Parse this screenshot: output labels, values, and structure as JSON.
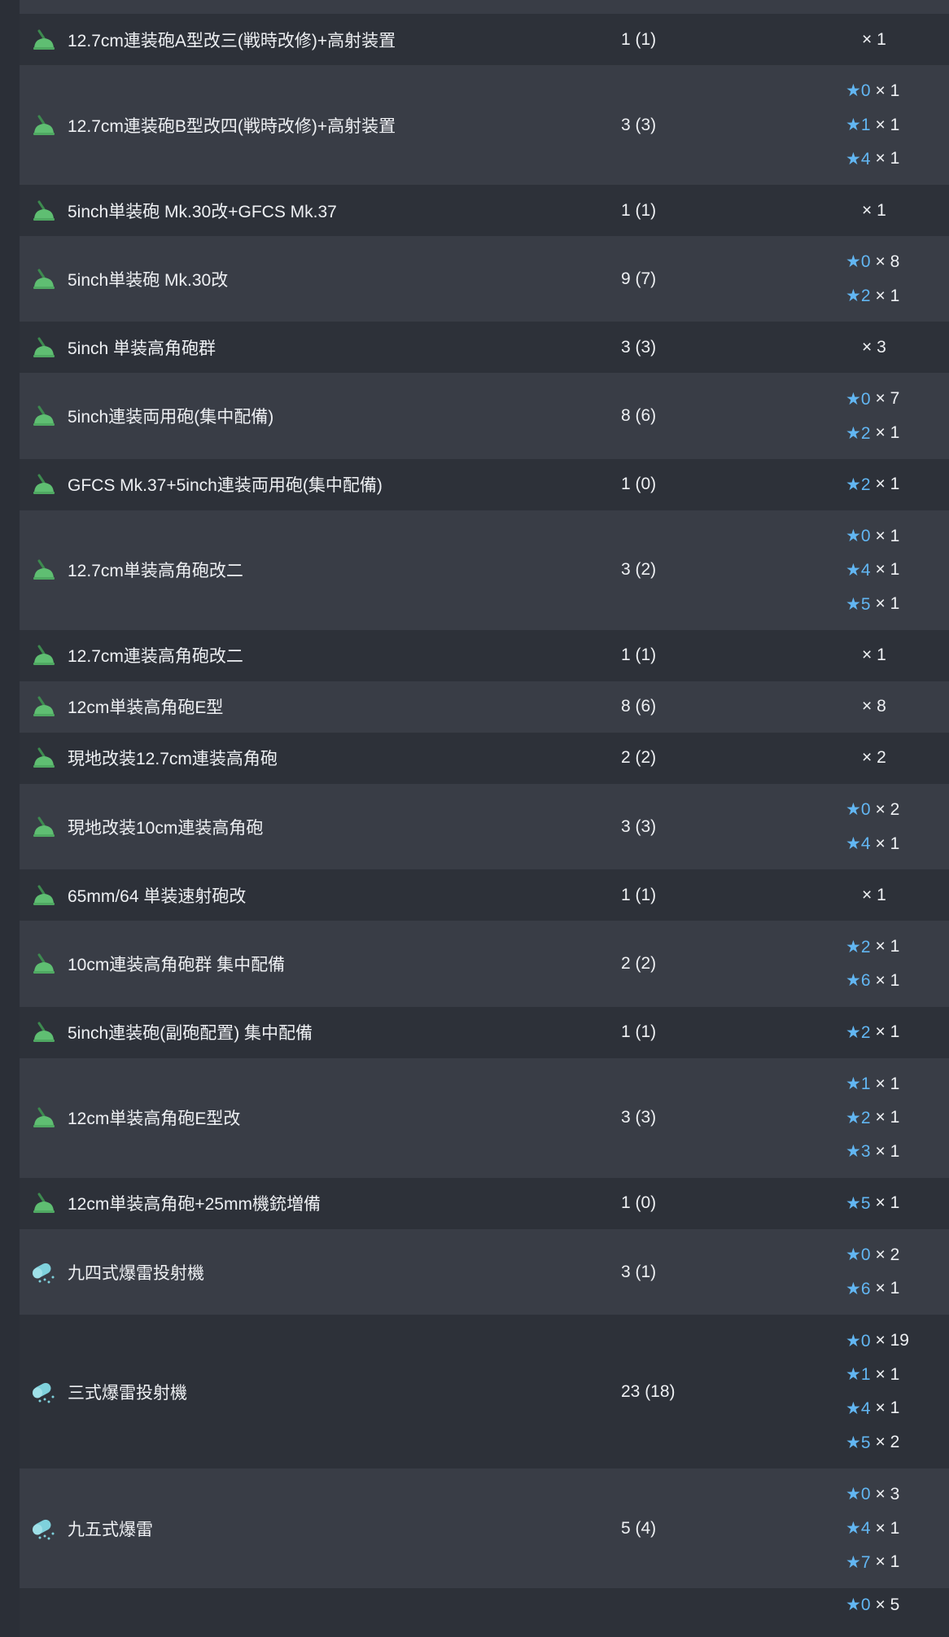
{
  "rows": [
    {
      "icon": "gun-mount-icon",
      "name": "12.7cm連装砲A型改三(戦時改修)+高射装置",
      "count": "1 (1)",
      "stars": [],
      "total": "× 1"
    },
    {
      "icon": "gun-mount-icon",
      "name": "12.7cm連装砲B型改四(戦時改修)+高射装置",
      "count": "3 (3)",
      "stars": [
        {
          "star": "★0",
          "mult": "× 1"
        },
        {
          "star": "★1",
          "mult": "× 1"
        },
        {
          "star": "★4",
          "mult": "× 1"
        }
      ]
    },
    {
      "icon": "gun-mount-icon",
      "name": "5inch単装砲 Mk.30改+GFCS Mk.37",
      "count": "1 (1)",
      "stars": [],
      "total": "× 1"
    },
    {
      "icon": "gun-mount-icon",
      "name": "5inch単装砲 Mk.30改",
      "count": "9 (7)",
      "stars": [
        {
          "star": "★0",
          "mult": "× 8"
        },
        {
          "star": "★2",
          "mult": "× 1"
        }
      ]
    },
    {
      "icon": "gun-mount-icon",
      "name": "5inch 単装高角砲群",
      "count": "3 (3)",
      "stars": [],
      "total": "× 3"
    },
    {
      "icon": "gun-mount-icon",
      "name": "5inch連装両用砲(集中配備)",
      "count": "8 (6)",
      "stars": [
        {
          "star": "★0",
          "mult": "× 7"
        },
        {
          "star": "★2",
          "mult": "× 1"
        }
      ]
    },
    {
      "icon": "gun-mount-icon",
      "name": "GFCS Mk.37+5inch連装両用砲(集中配備)",
      "count": "1 (0)",
      "stars": [
        {
          "star": "★2",
          "mult": "× 1"
        }
      ]
    },
    {
      "icon": "gun-mount-icon",
      "name": "12.7cm単装高角砲改二",
      "count": "3 (2)",
      "stars": [
        {
          "star": "★0",
          "mult": "× 1"
        },
        {
          "star": "★4",
          "mult": "× 1"
        },
        {
          "star": "★5",
          "mult": "× 1"
        }
      ]
    },
    {
      "icon": "gun-mount-icon",
      "name": "12.7cm連装高角砲改二",
      "count": "1 (1)",
      "stars": [],
      "total": "× 1"
    },
    {
      "icon": "gun-mount-icon",
      "name": "12cm単装高角砲E型",
      "count": "8 (6)",
      "stars": [],
      "total": "× 8"
    },
    {
      "icon": "gun-mount-icon",
      "name": "現地改装12.7cm連装高角砲",
      "count": "2 (2)",
      "stars": [],
      "total": "× 2"
    },
    {
      "icon": "gun-mount-icon",
      "name": "現地改装10cm連装高角砲",
      "count": "3 (3)",
      "stars": [
        {
          "star": "★0",
          "mult": "× 2"
        },
        {
          "star": "★4",
          "mult": "× 1"
        }
      ]
    },
    {
      "icon": "gun-mount-icon",
      "name": "65mm/64 単装速射砲改",
      "count": "1 (1)",
      "stars": [],
      "total": "× 1"
    },
    {
      "icon": "gun-mount-icon",
      "name": "10cm連装高角砲群 集中配備",
      "count": "2 (2)",
      "stars": [
        {
          "star": "★2",
          "mult": "× 1"
        },
        {
          "star": "★6",
          "mult": "× 1"
        }
      ]
    },
    {
      "icon": "gun-mount-icon",
      "name": "5inch連装砲(副砲配置) 集中配備",
      "count": "1 (1)",
      "stars": [
        {
          "star": "★2",
          "mult": "× 1"
        }
      ]
    },
    {
      "icon": "gun-mount-icon",
      "name": "12cm単装高角砲E型改",
      "count": "3 (3)",
      "stars": [
        {
          "star": "★1",
          "mult": "× 1"
        },
        {
          "star": "★2",
          "mult": "× 1"
        },
        {
          "star": "★3",
          "mult": "× 1"
        }
      ]
    },
    {
      "icon": "gun-mount-icon",
      "name": "12cm単装高角砲+25mm機銃増備",
      "count": "1 (0)",
      "stars": [
        {
          "star": "★5",
          "mult": "× 1"
        }
      ]
    },
    {
      "icon": "depth-charge-projector-icon",
      "name": "九四式爆雷投射機",
      "count": "3 (1)",
      "stars": [
        {
          "star": "★0",
          "mult": "× 2"
        },
        {
          "star": "★6",
          "mult": "× 1"
        }
      ]
    },
    {
      "icon": "depth-charge-projector-icon",
      "name": "三式爆雷投射機",
      "count": "23 (18)",
      "stars": [
        {
          "star": "★0",
          "mult": "× 19"
        },
        {
          "star": "★1",
          "mult": "× 1"
        },
        {
          "star": "★4",
          "mult": "× 1"
        },
        {
          "star": "★5",
          "mult": "× 2"
        }
      ]
    },
    {
      "icon": "depth-charge-projector-icon",
      "name": "九五式爆雷",
      "count": "5 (4)",
      "stars": [
        {
          "star": "★0",
          "mult": "× 3"
        },
        {
          "star": "★4",
          "mult": "× 1"
        },
        {
          "star": "★7",
          "mult": "× 1"
        }
      ]
    },
    {
      "partial": true,
      "stars": [
        {
          "star": "★0",
          "mult": "× 5"
        }
      ]
    }
  ],
  "colors": {
    "row_dark": "#2d3139",
    "row_light": "#393d46",
    "star_accent": "#62b6f2",
    "gun_icon": "#5fbe72",
    "depth_charge_icon": "#7fd1dc"
  }
}
